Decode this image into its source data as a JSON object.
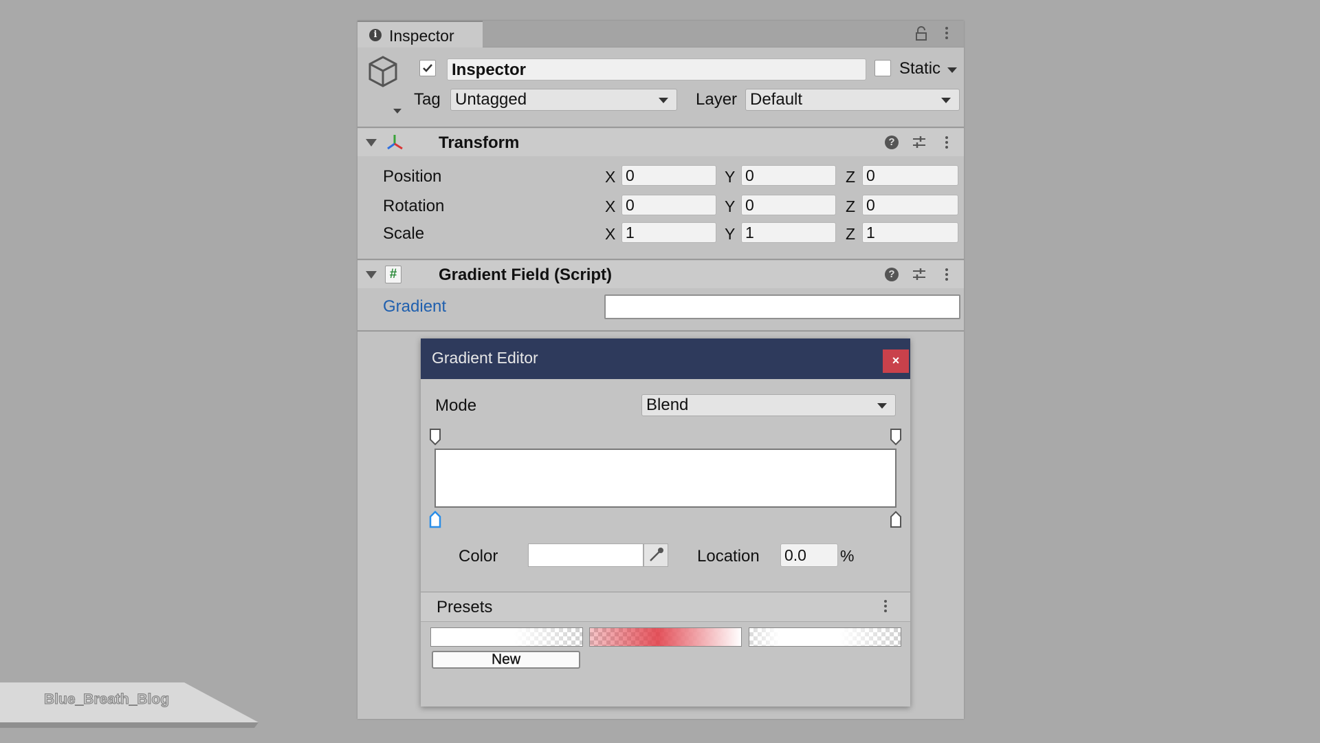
{
  "inspector": {
    "tab_label": "Inspector",
    "object": {
      "active": true,
      "name": "Inspector",
      "static_label": "Static",
      "static_checked": false,
      "tag_label": "Tag",
      "tag_value": "Untagged",
      "layer_label": "Layer",
      "layer_value": "Default"
    },
    "transform": {
      "title": "Transform",
      "rows": [
        {
          "label": "Position",
          "x": "0",
          "y": "0",
          "z": "0"
        },
        {
          "label": "Rotation",
          "x": "0",
          "y": "0",
          "z": "0"
        },
        {
          "label": "Scale",
          "x": "1",
          "y": "1",
          "z": "1"
        }
      ],
      "axis_x": "X",
      "axis_y": "Y",
      "axis_z": "Z"
    },
    "gradient_field": {
      "title": "Gradient Field (Script)",
      "script_icon": "#",
      "gradient_label": "Gradient"
    }
  },
  "gradient_editor": {
    "title": "Gradient Editor",
    "close_label": "×",
    "mode_label": "Mode",
    "mode_value": "Blend",
    "color_label": "Color",
    "location_label": "Location",
    "location_value": "0.0",
    "location_unit": "%",
    "presets_label": "Presets",
    "new_label": "New"
  },
  "watermark": "Blue_Breath_Blog",
  "colors": {
    "title_bar": "#2e3a5c",
    "close_button": "#c9414b",
    "gradient_label_link": "#1f5fae",
    "selected_key": "#2a8ee8"
  }
}
